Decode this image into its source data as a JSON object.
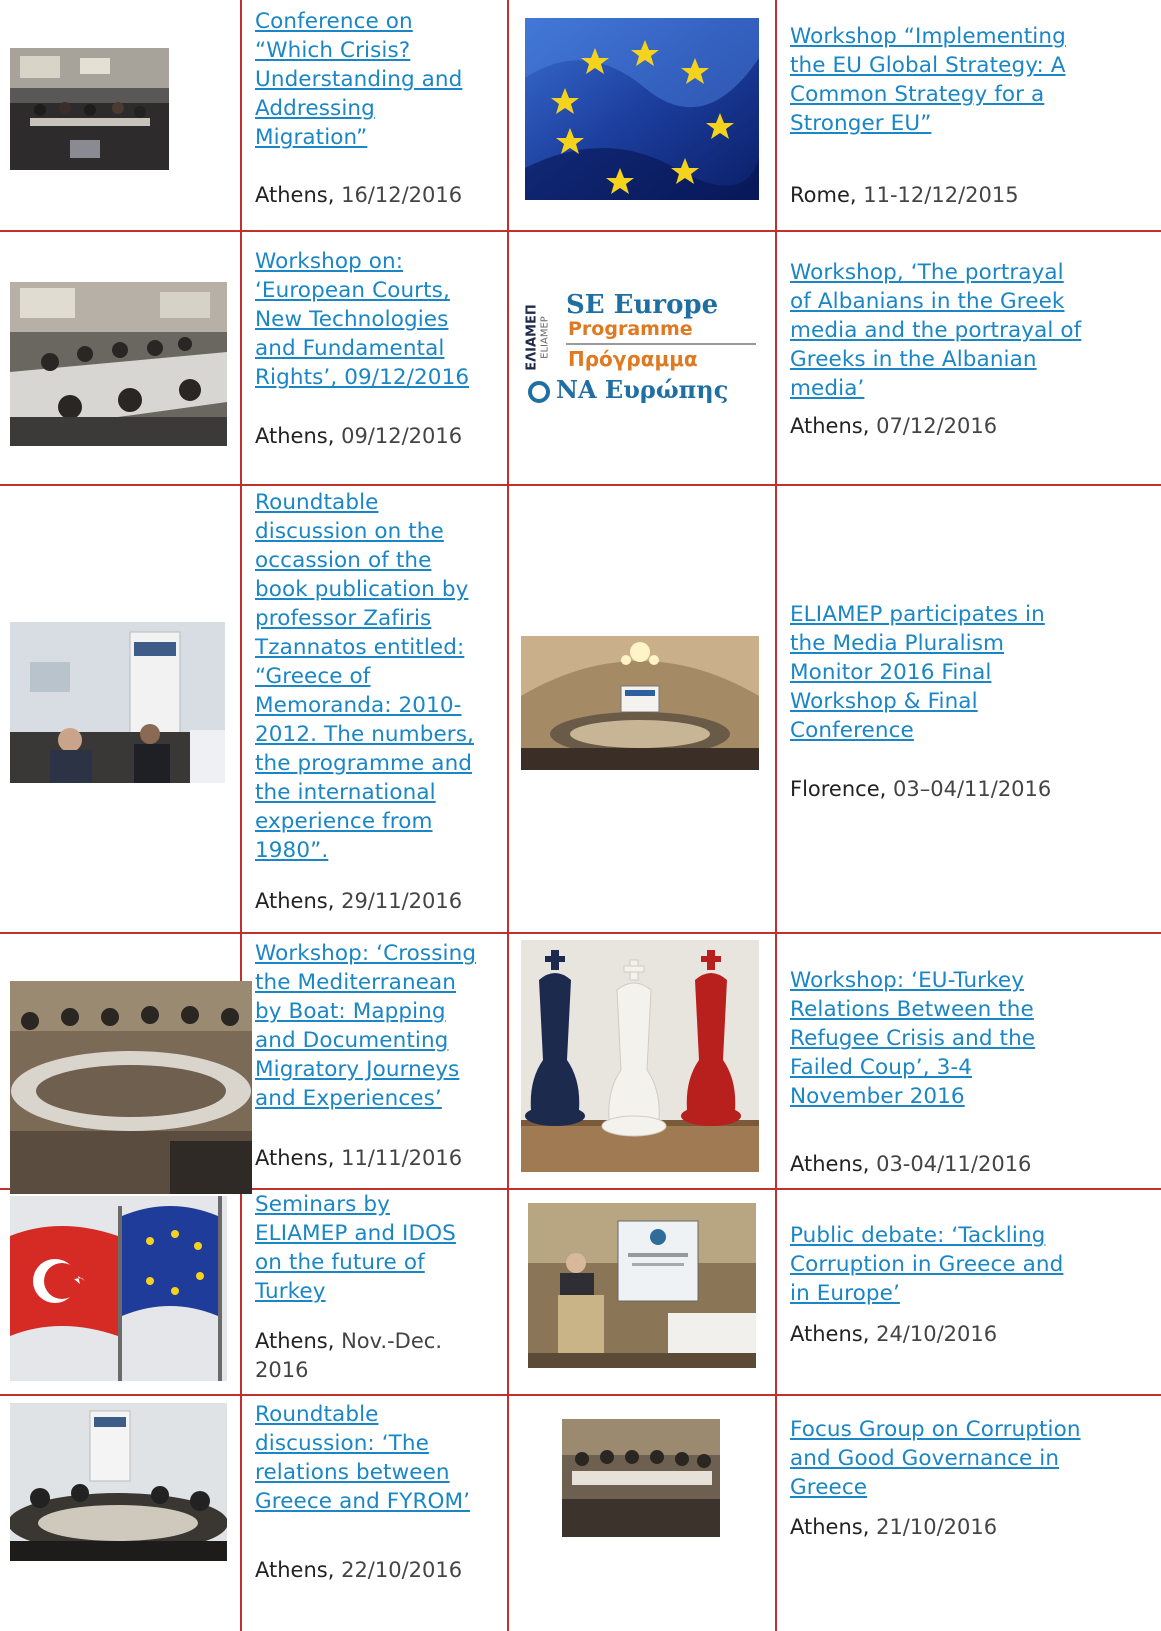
{
  "rows": [
    {
      "left": {
        "image": "conference-room-photo",
        "title": "Conference on “Which Crisis? Understanding and Addressing Migration”",
        "lines": [
          "Conference on",
          "“Which Crisis?",
          "Understanding and",
          "Addressing",
          "Migration”"
        ],
        "place": "Athens,",
        "date": "16/12/2016"
      },
      "right": {
        "image": "eu-flag-photo",
        "title": "Workshop “Implementing the EU Global Strategy: A Common Strategy for a Stronger EU”",
        "lines": [
          "Workshop “Implementing",
          "the EU Global Strategy: A",
          "Common Strategy for a",
          "Stronger EU”"
        ],
        "place": "Rome,",
        "date": "11-12/12/2015"
      }
    },
    {
      "left": {
        "image": "workshop-table-photo",
        "lines": [
          "Workshop on:",
          "‘European Courts,",
          "New Technologies",
          "and Fundamental",
          "Rights’, 09/12/2016"
        ],
        "place": "Athens,",
        "date": "09/12/2016"
      },
      "right": {
        "image": "se-europe-programme-logo",
        "logo": {
          "vertical1": "ΕΛΙΑΜΕΠ",
          "vertical2": "ELIAMEP",
          "line1": "SE Europe",
          "line2": "Programme",
          "line3": "Πρόγραμμα",
          "line4": "ΝΑ Ευρώπης"
        },
        "lines": [
          "Workshop, ‘The portrayal",
          "of Albanians in the Greek",
          "media and the portrayal of",
          "Greeks in the Albanian",
          "media’"
        ],
        "place": "Athens,",
        "date": "07/12/2016"
      }
    },
    {
      "left": {
        "image": "roundtable-speaker-photo",
        "lines": [
          "Roundtable",
          "discussion on the",
          "occassion of the",
          "book publication by",
          "professor Zafiris",
          "Tzannatos entitled:",
          "“Greece of",
          "Memoranda: 2010-",
          "2012. The numbers,",
          "the programme and",
          "the international",
          "experience from",
          "1980”."
        ],
        "place": "Athens,",
        "date": "29/11/2016"
      },
      "right": {
        "image": "chandelier-hall-photo",
        "lines": [
          "ELIAMEP participates in",
          "the Media Pluralism",
          "Monitor 2016 Final",
          "Workshop & Final",
          "Conference"
        ],
        "place": "Florence,",
        "date": "03–04/11/2016"
      }
    },
    {
      "left": {
        "image": "meeting-room-photo",
        "lines": [
          "Workshop: ‘Crossing",
          "the Mediterranean",
          "by Boat: Mapping",
          "and Documenting",
          "Migratory Journeys",
          "and Experiences’"
        ],
        "place": "Athens,",
        "date": "11/11/2016"
      },
      "right": {
        "image": "chess-kings-photo",
        "lines": [
          "Workshop: ‘EU-Turkey",
          "Relations Between the",
          "Refugee Crisis and the",
          "Failed Coup’, 3-4",
          "November 2016"
        ],
        "place": "Athens,",
        "date": "03-04/11/2016"
      }
    },
    {
      "left": {
        "image": "turkey-eu-flags-photo",
        "lines": [
          "Seminars by",
          "ELIAMEP and IDOS",
          "on the future of",
          "Turkey"
        ],
        "place": "Athens,",
        "date": "Nov.-Dec.",
        "date2": "2016"
      },
      "right": {
        "image": "podium-speaker-photo",
        "lines": [
          "Public debate: ‘Tackling",
          "Corruption in Greece and",
          "in Europe’"
        ],
        "place": "Athens,",
        "date": "24/10/2016"
      }
    },
    {
      "left": {
        "image": "roundtable-room-photo",
        "lines": [
          "Roundtable",
          "discussion: ‘The",
          "relations between",
          "Greece and FYROM’"
        ],
        "place": "Athens,",
        "date": "22/10/2016"
      },
      "right": {
        "image": "focus-group-photo",
        "lines": [
          "Focus Group on Corruption",
          "and Good Governance in",
          "Greece"
        ],
        "place": "Athens,",
        "date": "21/10/2016"
      }
    }
  ],
  "colors": {
    "grid": "#c0302c",
    "link": "#1a86c6",
    "text": "#222222"
  }
}
